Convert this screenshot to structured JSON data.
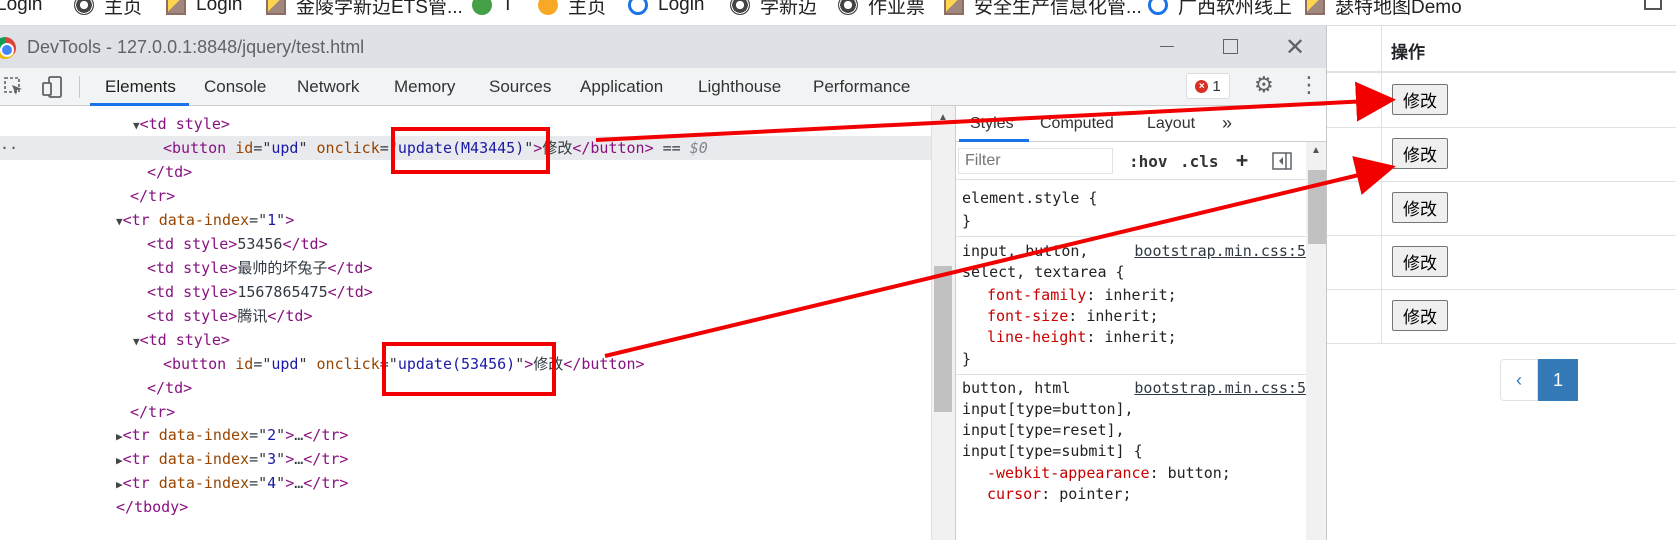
{
  "bookmarks": [
    {
      "label": "Login",
      "icon": "globe-icon"
    },
    {
      "label": "主页",
      "icon": "globe-icon"
    },
    {
      "label": "Login",
      "icon": "image-icon"
    },
    {
      "label": "金陵学新迈ETS管...",
      "icon": "image-icon"
    },
    {
      "label": "T",
      "icon": "green-circle-icon"
    },
    {
      "label": "主页",
      "icon": "bear-icon"
    },
    {
      "label": "Login",
      "icon": "blue-circle-icon"
    },
    {
      "label": "学新迈",
      "icon": "globe-icon"
    },
    {
      "label": "作业票",
      "icon": "globe-icon"
    },
    {
      "label": "安全生产信息化管...",
      "icon": "image-icon"
    },
    {
      "label": "广西软州线上",
      "icon": "blue-circle-icon"
    },
    {
      "label": "瑟特地图Demo",
      "icon": "image-icon"
    }
  ],
  "devtools": {
    "title": "DevTools - 127.0.0.1:8848/jquery/test.html",
    "close_glyph": "✕",
    "tabs": [
      "Elements",
      "Console",
      "Network",
      "Memory",
      "Sources",
      "Application",
      "Lighthouse",
      "Performance"
    ],
    "active_tab": "Elements",
    "error_count": "1",
    "gear_glyph": "⚙",
    "kebab_glyph": "⋮"
  },
  "tree": {
    "selected_marker": "··",
    "selected_suffix": " == ",
    "dollar": "$0",
    "nodes": {
      "td_style": "td style",
      "button": "button",
      "td": "td",
      "tr": "tr",
      "tbody": "tbody",
      "id_attr": "id",
      "id_val": "upd",
      "onclick_attr": "onclick",
      "onclick_val_1": "update(M43445)",
      "onclick_val_2": "update(53456)",
      "btn_text": "修改",
      "data_index_attr": "data-index",
      "idx1": "1",
      "idx2": "2",
      "idx3": "3",
      "idx4": "4",
      "cell_1": "53456",
      "cell_2": "最帅的坏兔子",
      "cell_3": "1567865475",
      "cell_4": "腾讯",
      "ellipsis": "…"
    }
  },
  "styles": {
    "tabs": [
      "Styles",
      "Computed",
      "Layout",
      "»"
    ],
    "filter_placeholder": "Filter",
    "hov": ":hov",
    "cls": ".cls",
    "plus": "+",
    "rule1_selector": "element.style {",
    "close_brace": "}",
    "rule2_selector_1": "input, button,",
    "rule2_selector_2": "select, textarea {",
    "rule2_source": "bootstrap.min.css:5",
    "ff_prop": "font-family",
    "ff_val": ": inherit;",
    "fs_prop": "font-size",
    "fs_val": ": inherit;",
    "lh_prop": "line-height",
    "lh_val": ": inherit;",
    "rule3_selector_1": "button, html",
    "rule3_selector_2": "input[type=button],",
    "rule3_selector_3": "input[type=reset],",
    "rule3_selector_4": "input[type=submit] {",
    "rule3_source": "bootstrap.min.css:5",
    "wa_prop": "-webkit-appearance",
    "wa_val": ": button;",
    "cur_prop": "cursor",
    "cur_val": ": pointer;"
  },
  "page": {
    "column_header": "操作",
    "edit_buttons": [
      "修改",
      "修改",
      "修改",
      "修改",
      "修改"
    ],
    "pager_prev": "‹",
    "pager_current": "1"
  },
  "colors": {
    "annotation_red": "#f20000",
    "devtools_accent": "#1a73e8",
    "tag_color": "#881280",
    "attr_name_color": "#994500",
    "attr_value_color": "#1a1aa6",
    "css_prop_color": "#c80000"
  }
}
